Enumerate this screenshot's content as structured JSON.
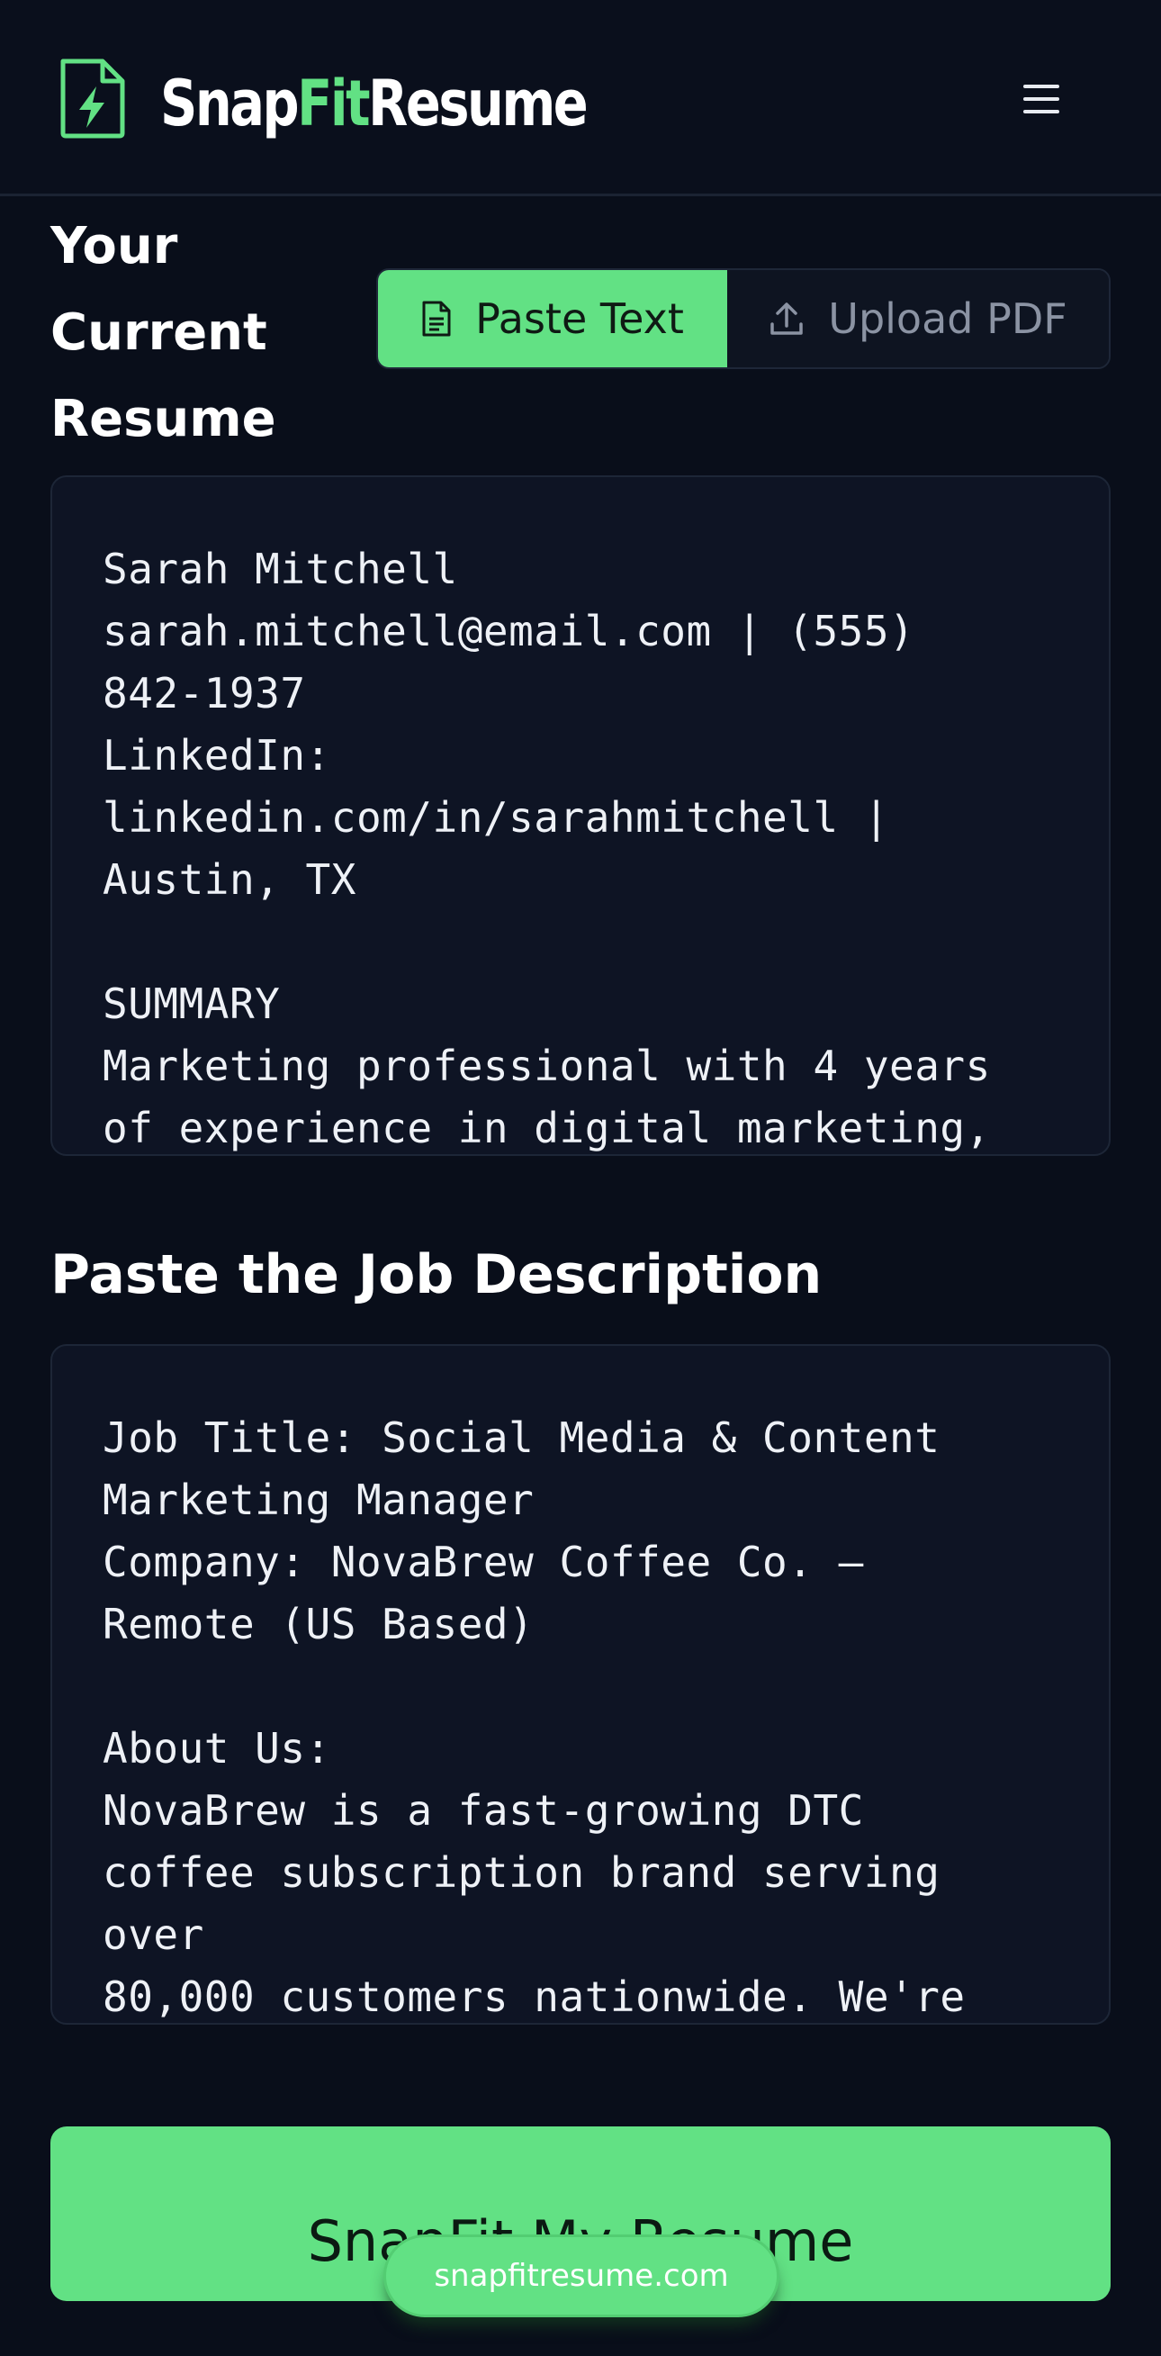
{
  "header": {
    "brand_part1": "Snap",
    "brand_part2": "Fit",
    "brand_part3": "Resume",
    "logo_icon": "lightning-document-icon",
    "menu_icon": "hamburger-menu-icon"
  },
  "resume_section": {
    "title": "Your Current Resume",
    "toggle": {
      "paste_label": "Paste Text",
      "upload_label": "Upload PDF",
      "selected": "Paste Text"
    },
    "text": "Sarah Mitchell\nsarah.mitchell@email.com | (555)\n842-1937\nLinkedIn:\nlinkedin.com/in/sarahmitchell |\nAustin, TX\n\nSUMMARY\nMarketing professional with 4 years\nof experience in digital marketing,"
  },
  "job_section": {
    "title": "Paste the Job Description",
    "text": "Job Title: Social Media & Content\nMarketing Manager\nCompany: NovaBrew Coffee Co. —\nRemote (US Based)\n\nAbout Us:\nNovaBrew is a fast-growing DTC\ncoffee subscription brand serving\nover\n80,000 customers nationwide. We're"
  },
  "cta": {
    "label": "SnapFit My Resume"
  },
  "url_badge": {
    "label": "snapfitresume.com"
  },
  "colors": {
    "accent": "#62e184",
    "background": "#090e1a",
    "panel": "#0e1424",
    "border": "#1d2637"
  }
}
